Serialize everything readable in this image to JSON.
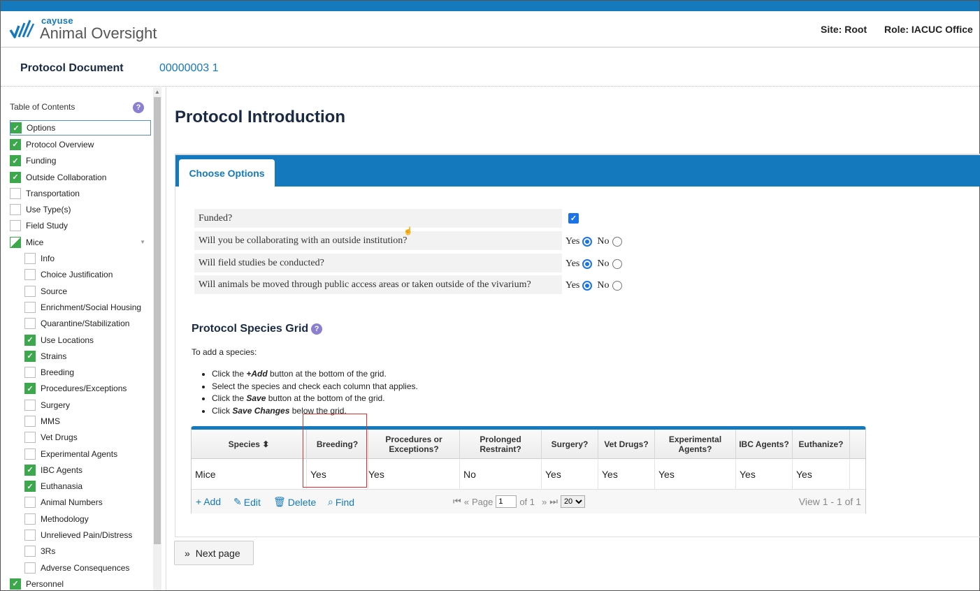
{
  "header": {
    "brand_small": "cayuse",
    "brand_big": "Animal Oversight",
    "site": "Site: Root",
    "role": "Role: IACUC Office"
  },
  "doc": {
    "label": "Protocol Document",
    "number": "00000003 1"
  },
  "toc": {
    "title": "Table of Contents",
    "items": [
      {
        "label": "Options",
        "state": "checked",
        "sub": false,
        "selected": true
      },
      {
        "label": "Protocol Overview",
        "state": "checked",
        "sub": false
      },
      {
        "label": "Funding",
        "state": "checked",
        "sub": false
      },
      {
        "label": "Outside Collaboration",
        "state": "checked",
        "sub": false
      },
      {
        "label": "Transportation",
        "state": "empty",
        "sub": false
      },
      {
        "label": "Use Type(s)",
        "state": "empty",
        "sub": false
      },
      {
        "label": "Field Study",
        "state": "empty",
        "sub": false
      },
      {
        "label": "Mice",
        "state": "partial",
        "sub": false,
        "expandable": true
      },
      {
        "label": "Info",
        "state": "empty",
        "sub": true
      },
      {
        "label": "Choice Justification",
        "state": "empty",
        "sub": true
      },
      {
        "label": "Source",
        "state": "empty",
        "sub": true
      },
      {
        "label": "Enrichment/Social Housing",
        "state": "empty",
        "sub": true
      },
      {
        "label": "Quarantine/Stabilization",
        "state": "empty",
        "sub": true
      },
      {
        "label": "Use Locations",
        "state": "checked",
        "sub": true
      },
      {
        "label": "Strains",
        "state": "checked",
        "sub": true
      },
      {
        "label": "Breeding",
        "state": "empty",
        "sub": true
      },
      {
        "label": "Procedures/Exceptions",
        "state": "checked",
        "sub": true
      },
      {
        "label": "Surgery",
        "state": "empty",
        "sub": true
      },
      {
        "label": "MMS",
        "state": "empty",
        "sub": true
      },
      {
        "label": "Vet Drugs",
        "state": "empty",
        "sub": true
      },
      {
        "label": "Experimental Agents",
        "state": "empty",
        "sub": true
      },
      {
        "label": "IBC Agents",
        "state": "checked",
        "sub": true
      },
      {
        "label": "Euthanasia",
        "state": "checked",
        "sub": true
      },
      {
        "label": "Animal Numbers",
        "state": "empty",
        "sub": true
      },
      {
        "label": "Methodology",
        "state": "empty",
        "sub": true
      },
      {
        "label": "Unrelieved Pain/Distress",
        "state": "empty",
        "sub": true
      },
      {
        "label": "3Rs",
        "state": "empty",
        "sub": true
      },
      {
        "label": "Adverse Consequences",
        "state": "empty",
        "sub": true
      },
      {
        "label": "Personnel",
        "state": "checked",
        "sub": false
      }
    ]
  },
  "main": {
    "title": "Protocol Introduction",
    "tab": "Choose Options",
    "questions": [
      {
        "text": "Funded?",
        "type": "checkbox",
        "value": true
      },
      {
        "text": "Will you be collaborating with an outside institution?",
        "type": "radio",
        "yes": "Yes",
        "no": "No",
        "value": "Yes"
      },
      {
        "text": "Will field studies be conducted?",
        "type": "radio",
        "yes": "Yes",
        "no": "No",
        "value": "Yes"
      },
      {
        "text": "Will animals be moved through public access areas or taken outside of the vivarium?",
        "type": "radio",
        "yes": "Yes",
        "no": "No",
        "value": "Yes"
      }
    ],
    "grid_title": "Protocol Species Grid",
    "instructions_intro": "To add a species:",
    "instructions": [
      {
        "pre": "Click the ",
        "bold": "+Add",
        "post": " button at the bottom of the grid."
      },
      {
        "pre": "Select the species and check each column that applies.",
        "bold": "",
        "post": ""
      },
      {
        "pre": "Click the ",
        "bold": "Save",
        "post": " button at the bottom of the grid."
      },
      {
        "pre": "Click ",
        "bold": "Save Changes",
        "post": " below the grid."
      }
    ],
    "grid": {
      "columns": [
        "Species ⬍",
        "Breeding?",
        "Procedures or Exceptions?",
        "Prolonged Restraint?",
        "Surgery?",
        "Vet Drugs?",
        "Experimental Agents?",
        "IBC Agents?",
        "Euthanize?"
      ],
      "rows": [
        [
          "Mice",
          "Yes",
          "Yes",
          "No",
          "Yes",
          "Yes",
          "Yes",
          "Yes",
          "Yes"
        ]
      ],
      "footer": {
        "add": "Add",
        "edit": "Edit",
        "delete": "Delete",
        "find": "Find",
        "page_label": "Page",
        "page_value": "1",
        "of_label": "of 1",
        "rows_per_page": "20",
        "view_info": "View 1 - 1 of 1"
      }
    },
    "next_button": "Next page"
  },
  "colors": {
    "brand_blue": "#1479bd",
    "check_green": "#3aa84b",
    "highlight_red": "#e03030"
  }
}
